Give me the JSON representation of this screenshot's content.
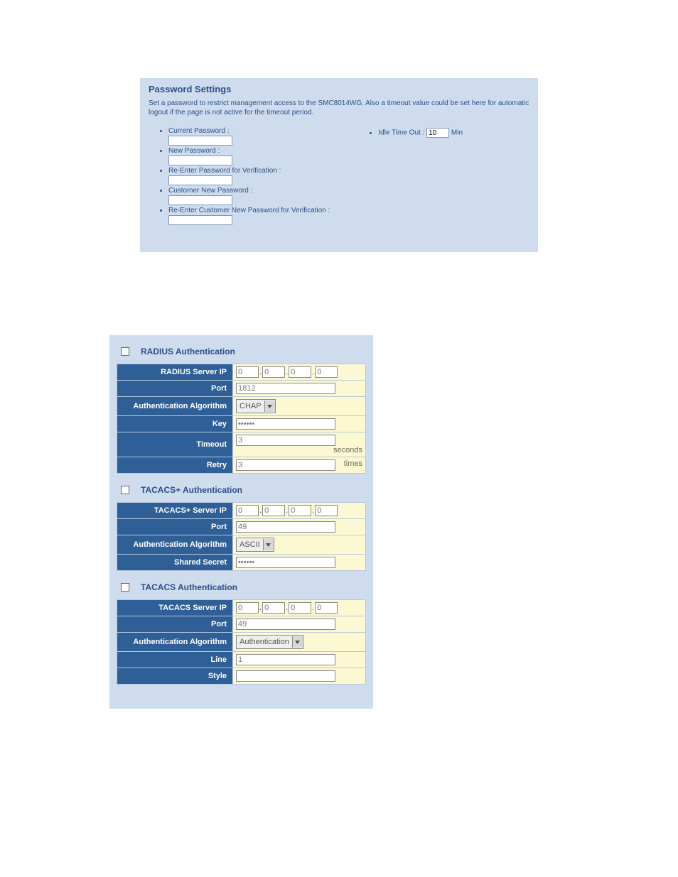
{
  "password_panel": {
    "title": "Password Settings",
    "description": "Set a password to restrict management access to the SMC8014WG. Also a timeout value could be set here for automatic logout if the page is not active for the timeout period.",
    "fields": {
      "current_password": "Current Password :",
      "new_password": "New Password :",
      "reenter_password": "Re-Enter Password for Verification :",
      "customer_new_password": "Customer New Password :",
      "reenter_customer_password": "Re-Enter Customer New Password for Verification :"
    },
    "idle": {
      "label_prefix": "Idle Time Out :",
      "value": "10",
      "unit": "Min"
    }
  },
  "radius": {
    "title": "RADIUS Authentication",
    "labels": {
      "server_ip": "RADIUS Server IP",
      "port": "Port",
      "algo": "Authentication Algorithm",
      "key": "Key",
      "timeout": "Timeout",
      "retry": "Retry"
    },
    "values": {
      "ip": [
        "0",
        "0",
        "0",
        "0"
      ],
      "port": "1812",
      "algo": "CHAP",
      "key": "••••••",
      "timeout": "3",
      "timeout_unit": "seconds",
      "retry": "3",
      "retry_unit": "times"
    }
  },
  "tacacs_plus": {
    "title": "TACACS+ Authentication",
    "labels": {
      "server_ip": "TACACS+ Server IP",
      "port": "Port",
      "algo": "Authentication Algorithm",
      "secret": "Shared Secret"
    },
    "values": {
      "ip": [
        "0",
        "0",
        "0",
        "0"
      ],
      "port": "49",
      "algo": "ASCII",
      "secret": "••••••"
    }
  },
  "tacacs": {
    "title": "TACACS Authentication",
    "labels": {
      "server_ip": "TACACS Server IP",
      "port": "Port",
      "algo": "Authentication Algorithm",
      "line": "Line",
      "style": "Style"
    },
    "values": {
      "ip": [
        "0",
        "0",
        "0",
        "0"
      ],
      "port": "49",
      "algo": "Authentication",
      "line": "1",
      "style": ""
    }
  }
}
